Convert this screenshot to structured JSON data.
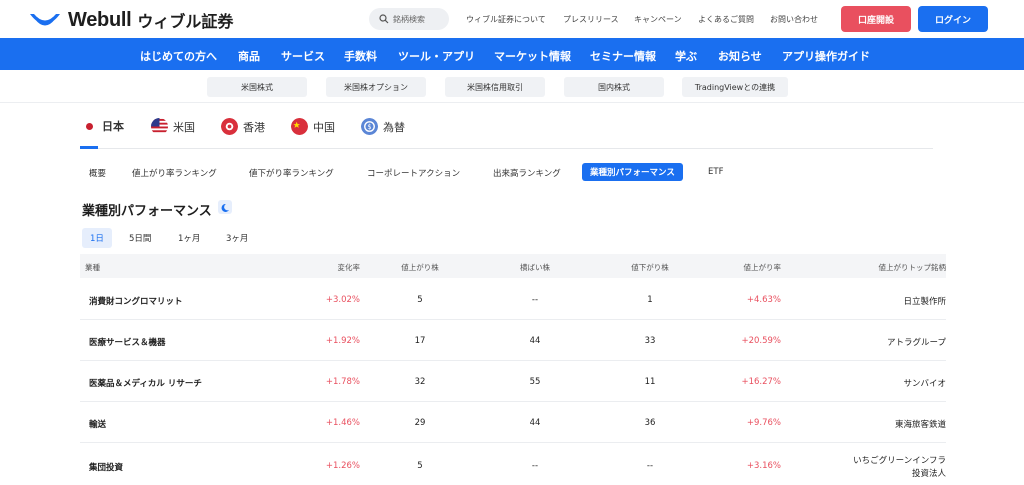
{
  "header": {
    "logo_text": "Webull",
    "logo_jp": "ウィブル証券",
    "search_placeholder": "銘柄検索",
    "links": [
      "ウィブル証券について",
      "プレスリリース",
      "キャンペーン",
      "よくあるご質問",
      "お問い合わせ"
    ],
    "open_account": "口座開設",
    "login": "ログイン"
  },
  "main_nav": [
    "はじめての方へ",
    "商品",
    "サービス",
    "手数料",
    "ツール・アプリ",
    "マーケット情報",
    "セミナー情報",
    "学ぶ",
    "お知らせ",
    "アプリ操作ガイド"
  ],
  "sub_nav": [
    "米国株式",
    "米国株オプション",
    "米国株信用取引",
    "国内株式",
    "TradingViewとの連携"
  ],
  "markets": [
    "日本",
    "米国",
    "香港",
    "中国",
    "為替"
  ],
  "data_tabs": [
    "概要",
    "値上がり率ランキング",
    "値下がり率ランキング",
    "コーポレートアクション",
    "出来高ランキング",
    "業種別パフォーマンス",
    "ETF"
  ],
  "section_title": "業種別パフォーマンス",
  "periods": [
    "1日",
    "5日間",
    "1ヶ月",
    "3ヶ月"
  ],
  "table": {
    "headers": [
      "業種",
      "変化率",
      "値上がり株",
      "横ばい株",
      "値下がり株",
      "値上がり率",
      "値上がりトップ銘柄"
    ],
    "rows": [
      {
        "industry": "消費財コングロマリット",
        "change": "+3.02%",
        "up": "5",
        "flat": "--",
        "down": "1",
        "top_rate": "+4.63%",
        "top_stock": "日立製作所",
        "top_stock2": ""
      },
      {
        "industry": "医療サービス＆機器",
        "change": "+1.92%",
        "up": "17",
        "flat": "44",
        "down": "33",
        "top_rate": "+20.59%",
        "top_stock": "アトラグループ",
        "top_stock2": ""
      },
      {
        "industry": "医薬品＆メディカル リサーチ",
        "change": "+1.78%",
        "up": "32",
        "flat": "55",
        "down": "11",
        "top_rate": "+16.27%",
        "top_stock": "サンバイオ",
        "top_stock2": ""
      },
      {
        "industry": "輸送",
        "change": "+1.46%",
        "up": "29",
        "flat": "44",
        "down": "36",
        "top_rate": "+9.76%",
        "top_stock": "東海旅客鉄道",
        "top_stock2": ""
      },
      {
        "industry": "集団投資",
        "change": "+1.26%",
        "up": "5",
        "flat": "--",
        "down": "--",
        "top_rate": "+3.16%",
        "top_stock": "いちごグリーンインフラ",
        "top_stock2": "投資法人"
      }
    ]
  },
  "colors": {
    "brand_blue": "#1a6ff0",
    "accent_red": "#e9505f"
  }
}
